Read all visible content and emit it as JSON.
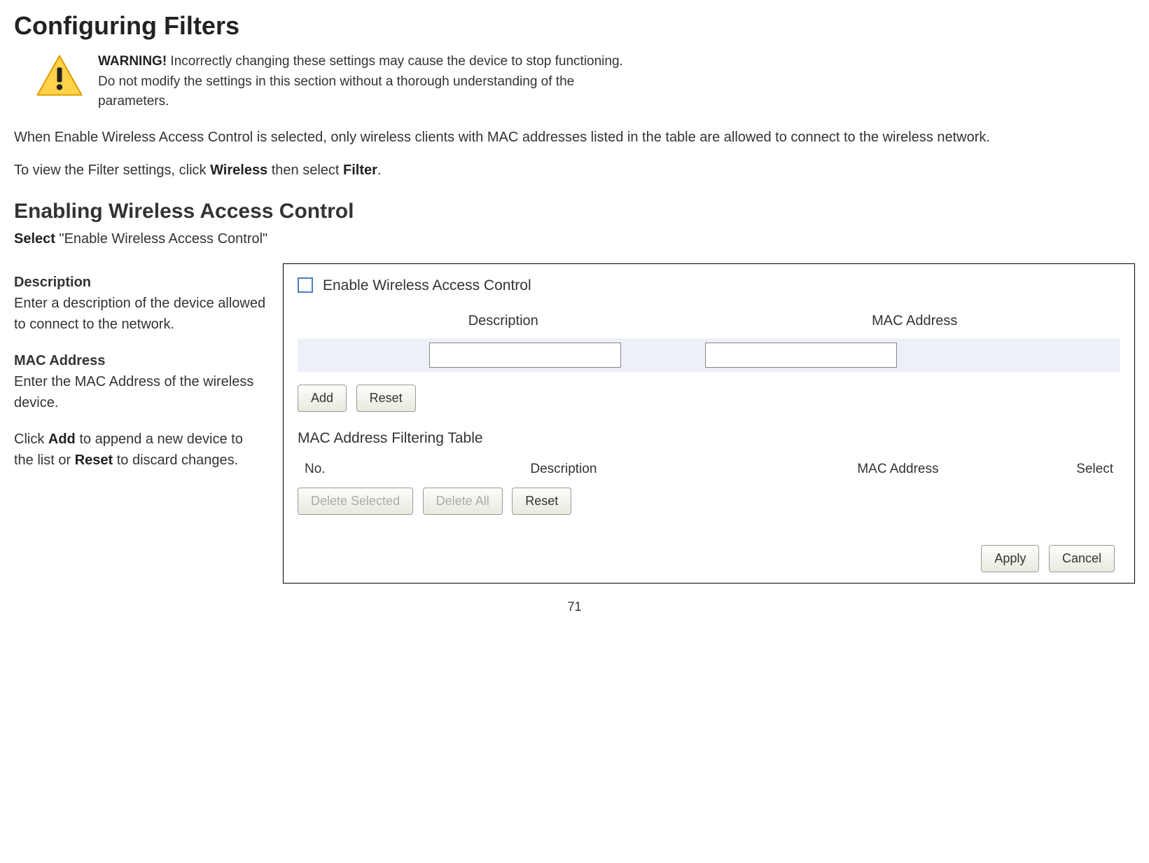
{
  "page": {
    "title": "Configuring Filters",
    "number": "71"
  },
  "warning": {
    "prefix": "WARNING!",
    "text": " Incorrectly changing these settings may cause the device to stop functioning. Do not modify the settings in this section without a thorough understanding of the parameters."
  },
  "intro": {
    "para1": "When Enable Wireless Access Control is selected, only wireless clients with MAC addresses listed in the table are allowed to connect to the wireless network.",
    "para2_pre": "To view the Filter settings, click ",
    "para2_b1": "Wireless",
    "para2_mid": " then select ",
    "para2_b2": "Filter",
    "para2_post": "."
  },
  "section2": {
    "heading": "Enabling Wireless Access Control",
    "sub_pre": "Select",
    "sub_post": " \"Enable Wireless Access Control\"",
    "desc_title": "Description",
    "desc_body": "Enter a description of the device allowed to connect to the network.",
    "mac_title": "MAC Address",
    "mac_body": "Enter the MAC Address of the wireless device.",
    "click_pre": "Click ",
    "click_b1": "Add",
    "click_mid": " to append a new device to the list or ",
    "click_b2": "Reset",
    "click_post": " to discard changes."
  },
  "panel": {
    "enable_label": "Enable Wireless Access Control",
    "col_desc": "Description",
    "col_mac": "MAC Address",
    "btn_add": "Add",
    "btn_reset_top": "Reset",
    "table_title": "MAC Address Filtering Table",
    "th_no": "No.",
    "th_desc": "Description",
    "th_mac": "MAC Address",
    "th_sel": "Select",
    "btn_delete_selected": "Delete Selected",
    "btn_delete_all": "Delete All",
    "btn_reset_bottom": "Reset",
    "btn_apply": "Apply",
    "btn_cancel": "Cancel"
  }
}
